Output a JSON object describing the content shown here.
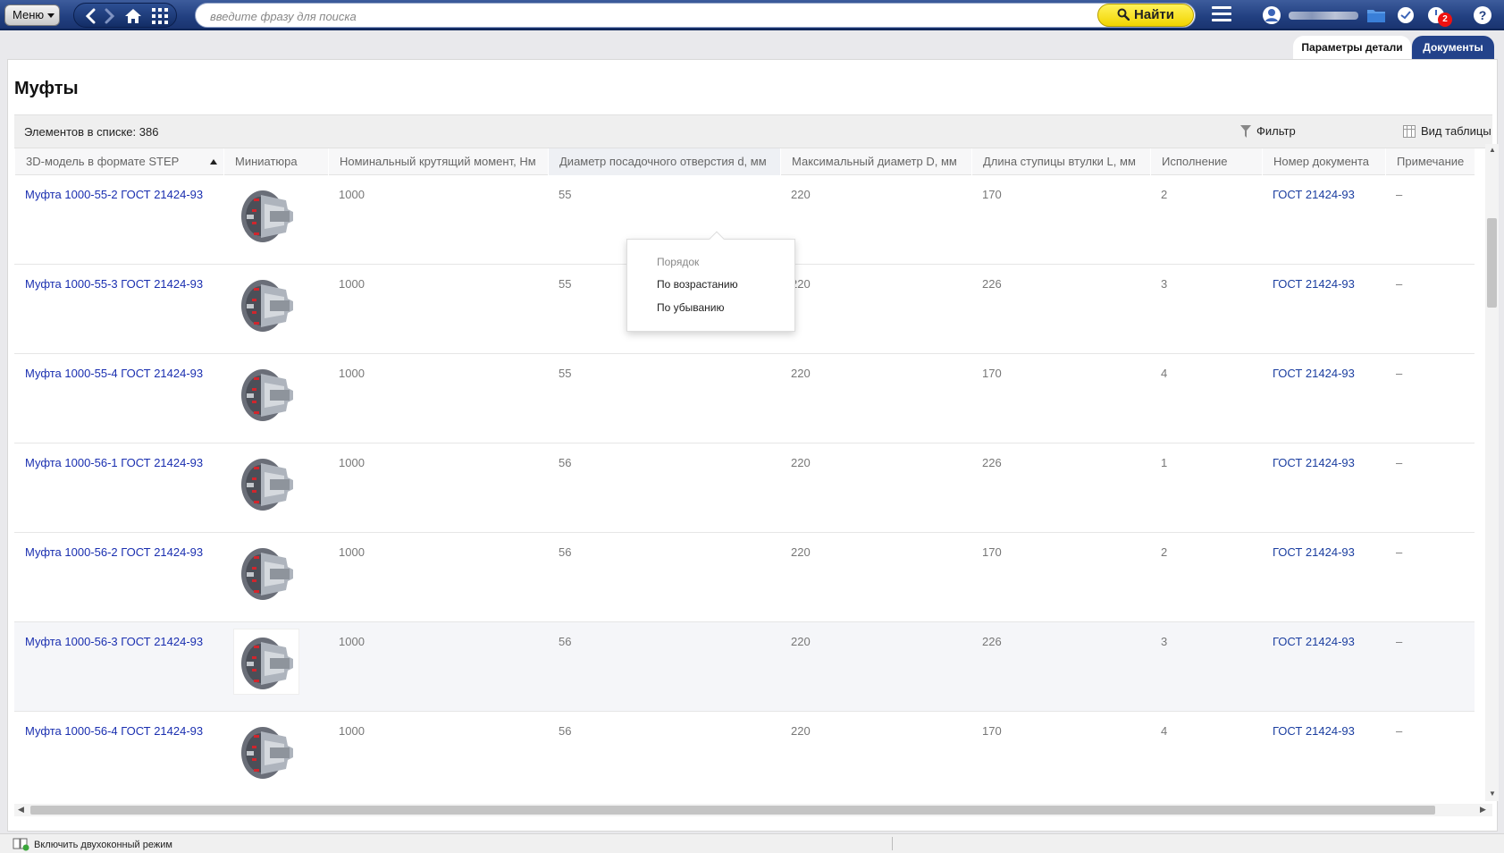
{
  "topbar": {
    "menu_label": "Меню",
    "search_placeholder": "введите фразу для поиска",
    "find_label": "Найти",
    "notification_count": "2"
  },
  "tabs": [
    {
      "label": "Параметры детали"
    },
    {
      "label": "Документы"
    }
  ],
  "page": {
    "title": "Муфты",
    "count_label": "Элементов в списке: 386",
    "filter_label": "Фильтр",
    "table_view_label": "Вид таблицы"
  },
  "table": {
    "columns": [
      "3D-модель в формате STEP",
      "Миниатюра",
      "Номинальный крутящий момент, Нм",
      "Диаметр посадочного отверстия d, мм",
      "Максимальный диаметр D, мм",
      "Длина ступицы втулки L, мм",
      "Исполнение",
      "Номер документа",
      "Примечание"
    ],
    "rows": [
      {
        "model": "Муфта 1000-55-2 ГОСТ 21424-93",
        "torque": "1000",
        "d": "55",
        "D": "220",
        "L": "170",
        "execution": "2",
        "doc": "ГОСТ 21424-93",
        "note": "–"
      },
      {
        "model": "Муфта 1000-55-3 ГОСТ 21424-93",
        "torque": "1000",
        "d": "55",
        "D": "220",
        "L": "226",
        "execution": "3",
        "doc": "ГОСТ 21424-93",
        "note": "–"
      },
      {
        "model": "Муфта 1000-55-4 ГОСТ 21424-93",
        "torque": "1000",
        "d": "55",
        "D": "220",
        "L": "170",
        "execution": "4",
        "doc": "ГОСТ 21424-93",
        "note": "–"
      },
      {
        "model": "Муфта 1000-56-1 ГОСТ 21424-93",
        "torque": "1000",
        "d": "56",
        "D": "220",
        "L": "226",
        "execution": "1",
        "doc": "ГОСТ 21424-93",
        "note": "–"
      },
      {
        "model": "Муфта 1000-56-2 ГОСТ 21424-93",
        "torque": "1000",
        "d": "56",
        "D": "220",
        "L": "170",
        "execution": "2",
        "doc": "ГОСТ 21424-93",
        "note": "–"
      },
      {
        "model": "Муфта 1000-56-3 ГОСТ 21424-93",
        "torque": "1000",
        "d": "56",
        "D": "220",
        "L": "226",
        "execution": "3",
        "doc": "ГОСТ 21424-93",
        "note": "–"
      },
      {
        "model": "Муфта 1000-56-4 ГОСТ 21424-93",
        "torque": "1000",
        "d": "56",
        "D": "220",
        "L": "170",
        "execution": "4",
        "doc": "ГОСТ 21424-93",
        "note": "–"
      }
    ]
  },
  "sort_menu": {
    "title": "Порядок",
    "ascending": "По возрастанию",
    "descending": "По убыванию"
  },
  "statusbar": {
    "dual_window_label": "Включить двухоконный режим"
  }
}
